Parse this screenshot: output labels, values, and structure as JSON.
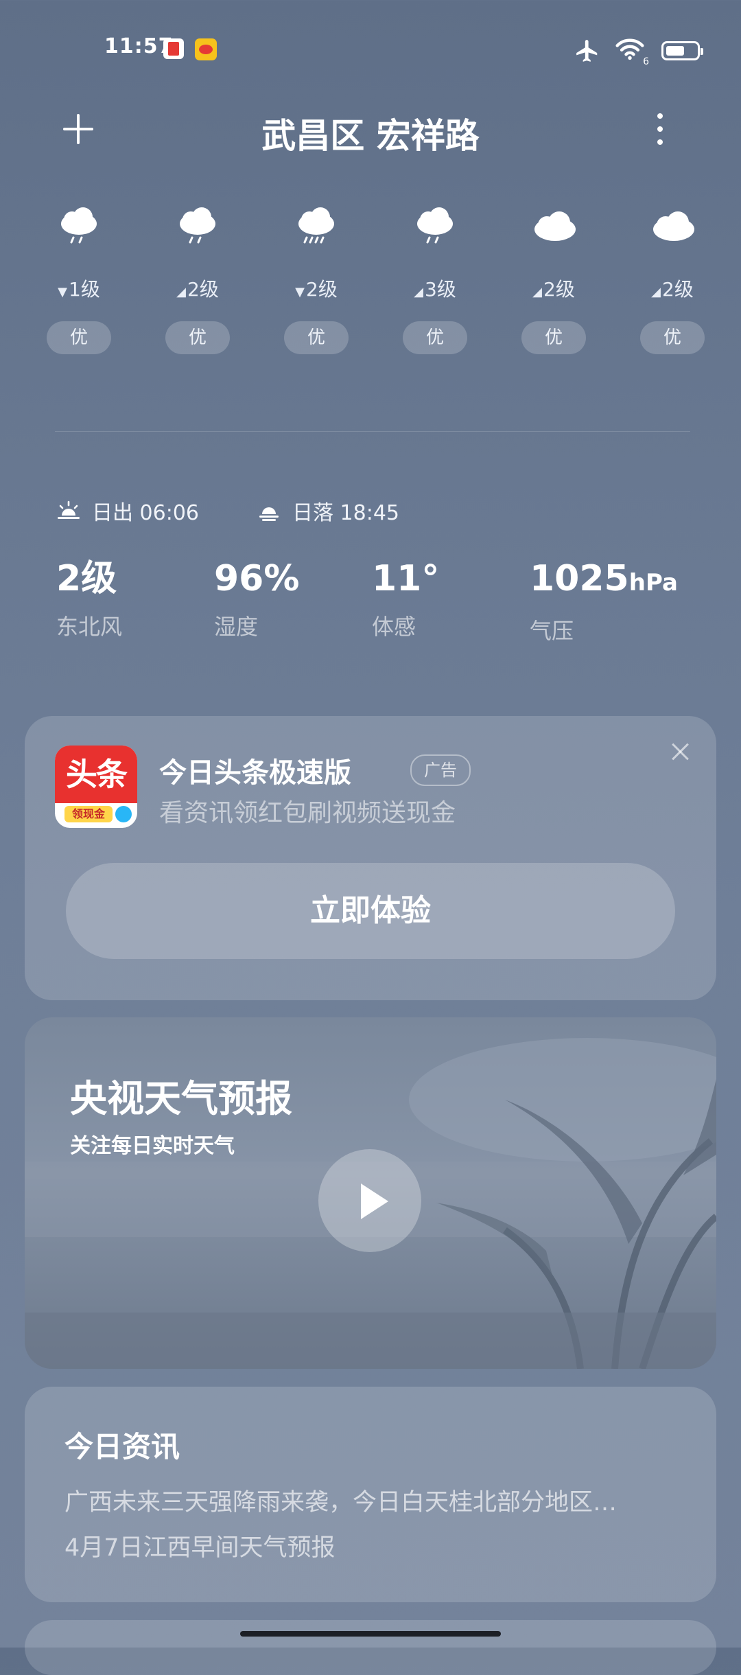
{
  "status_bar": {
    "time": "11:57",
    "notification_icons": [
      "red-app-icon",
      "weibo-icon"
    ],
    "system_icons": [
      "airplane-mode-icon",
      "wifi-icon",
      "battery-icon"
    ],
    "wifi_label": "6"
  },
  "header": {
    "title": "武昌区 宏祥路",
    "add_icon": "plus-icon",
    "menu_icon": "more-vertical-icon"
  },
  "hourly": [
    {
      "icon": "light-rain-icon",
      "wind": "1级",
      "wind_dir": "▼",
      "aqi": "优"
    },
    {
      "icon": "light-rain-icon",
      "wind": "2级",
      "wind_dir": "◢",
      "aqi": "优"
    },
    {
      "icon": "moderate-rain-icon",
      "wind": "2级",
      "wind_dir": "▼",
      "aqi": "优"
    },
    {
      "icon": "light-rain-icon",
      "wind": "3级",
      "wind_dir": "◢",
      "aqi": "优"
    },
    {
      "icon": "cloudy-icon",
      "wind": "2级",
      "wind_dir": "◢",
      "aqi": "优"
    },
    {
      "icon": "cloudy-icon",
      "wind": "2级",
      "wind_dir": "◢",
      "aqi": "优"
    }
  ],
  "sun": {
    "sunrise_label": "日出 06:06",
    "sunset_label": "日落 18:45"
  },
  "stats": [
    {
      "value": "2级",
      "unit": "",
      "label": "东北风"
    },
    {
      "value": "96%",
      "unit": "",
      "label": "湿度"
    },
    {
      "value": "11°",
      "unit": "",
      "label": "体感"
    },
    {
      "value": "1025",
      "unit": "hPa",
      "label": "气压"
    }
  ],
  "ad": {
    "logo_text": "头条",
    "logo_sub": "领现金",
    "name": "今日头条极速版",
    "badge": "广告",
    "description": "看资讯领红包刷视频送现金",
    "button": "立即体验",
    "colors": {
      "logo_red": "#e8312f",
      "logo_yellow": "#ffd54a"
    }
  },
  "video": {
    "title": "央视天气预报",
    "subtitle": "关注每日实时天气"
  },
  "news": {
    "heading": "今日资讯",
    "items": [
      "广西未来三天强降雨来袭，今日白天桂北部分地区…",
      "4月7日江西早间天气预报"
    ]
  },
  "colors": {
    "background": "#66768f",
    "card": "rgba(255,255,255,0.16)"
  }
}
